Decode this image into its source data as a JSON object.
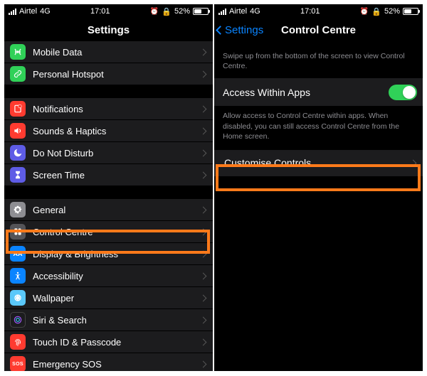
{
  "status": {
    "carrier": "Airtel",
    "net": "4G",
    "time": "17:01",
    "battery": "52%"
  },
  "left": {
    "title": "Settings",
    "rows": {
      "mobile_data": "Mobile Data",
      "personal_hotspot": "Personal Hotspot",
      "notifications": "Notifications",
      "sounds": "Sounds & Haptics",
      "dnd": "Do Not Disturb",
      "screen_time": "Screen Time",
      "general": "General",
      "control_centre": "Control Centre",
      "display": "Display & Brightness",
      "accessibility": "Accessibility",
      "wallpaper": "Wallpaper",
      "siri": "Siri & Search",
      "touchid": "Touch ID & Passcode",
      "emergency": "Emergency SOS"
    }
  },
  "right": {
    "back": "Settings",
    "title": "Control Centre",
    "desc1": "Swipe up from the bottom of the screen to view Control Centre.",
    "access_label": "Access Within Apps",
    "desc2": "Allow access to Control Centre within apps. When disabled, you can still access Control Centre from the Home screen.",
    "customise": "Customise Controls"
  }
}
